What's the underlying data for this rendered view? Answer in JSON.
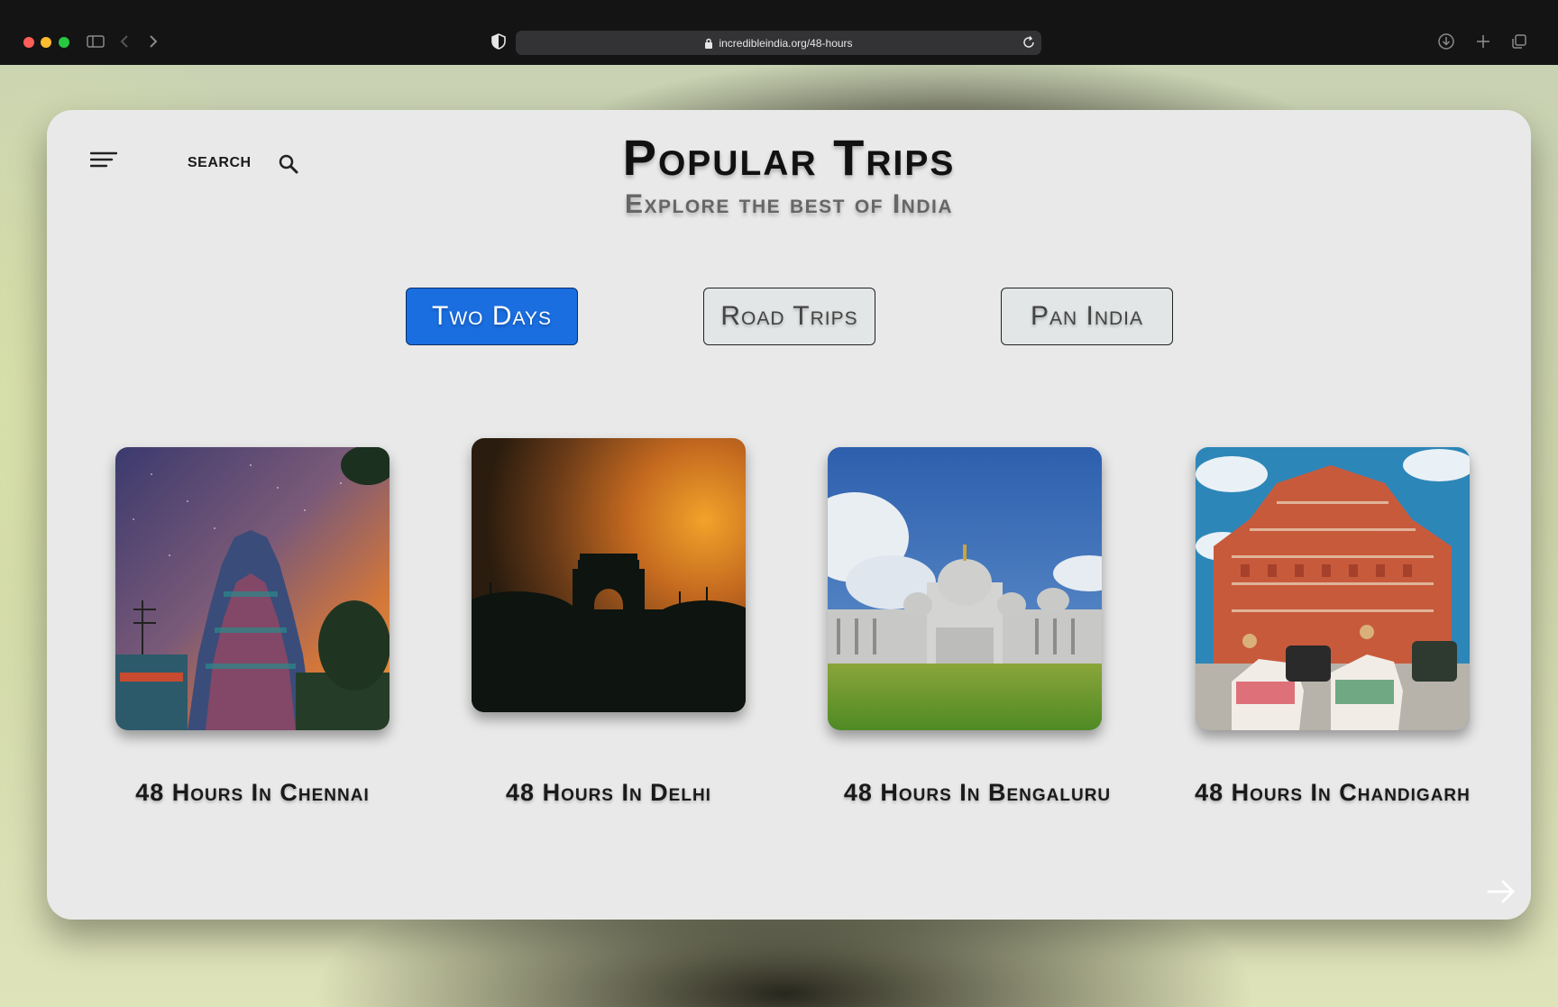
{
  "browser": {
    "url": "incredibleindia.org/48-hours"
  },
  "header": {
    "search_label": "SEARCH",
    "title": "Popular Trips",
    "subtitle": "Explore the best of India"
  },
  "tabs": [
    {
      "label": "Two Days",
      "active": true
    },
    {
      "label": "Road Trips",
      "active": false
    },
    {
      "label": "Pan India",
      "active": false
    }
  ],
  "trips": [
    {
      "caption": "48 Hours In Chennai",
      "image": "chennai-temple-image"
    },
    {
      "caption": "48 Hours In Delhi",
      "image": "india-gate-sunset-image"
    },
    {
      "caption": "48 Hours In Bengaluru",
      "image": "vidhana-soudha-image"
    },
    {
      "caption": "48 Hours In Chandigarh",
      "image": "hawa-mahal-image"
    }
  ],
  "colors": {
    "accent": "#1a6ee0",
    "card_bg": "#e9e9e9"
  },
  "icons": {
    "menu": "hamburger-icon",
    "search": "search-icon",
    "next": "arrow-right-icon"
  }
}
